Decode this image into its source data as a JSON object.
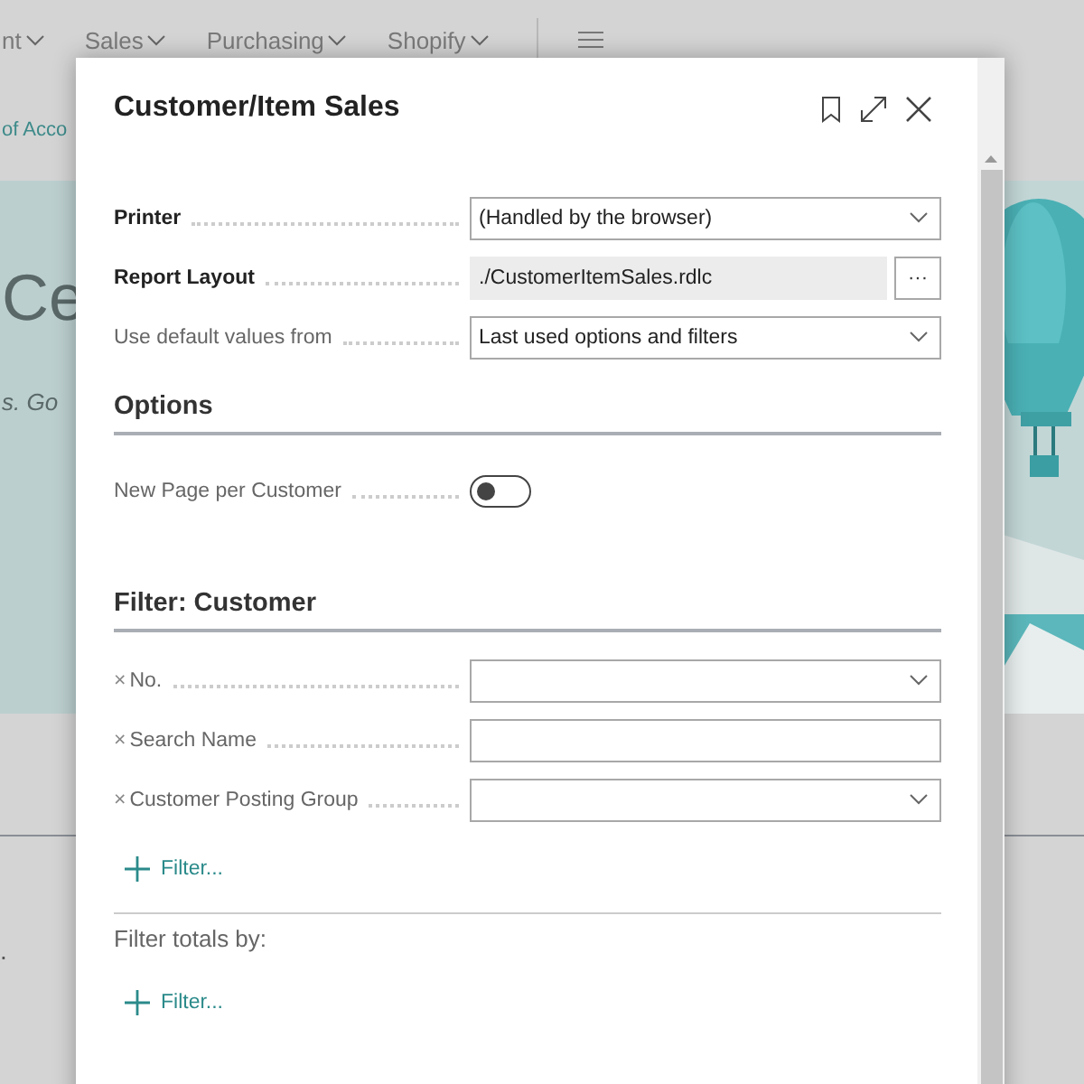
{
  "background": {
    "nav": [
      {
        "label": "nt"
      },
      {
        "label": "Sales"
      },
      {
        "label": "Purchasing"
      },
      {
        "label": "Shopify"
      }
    ],
    "link": "of Acco",
    "hero_title": "Ce",
    "hero_text": "s. Go",
    "footnote": "."
  },
  "dialog": {
    "title": "Customer/Item Sales",
    "fields": [
      {
        "label": "Printer",
        "bold": true,
        "kind": "dropdown",
        "value": "(Handled by the browser)"
      },
      {
        "label": "Report Layout",
        "bold": true,
        "kind": "lookup",
        "value": "./CustomerItemSales.rdlc",
        "button": "···"
      },
      {
        "label": "Use default values from",
        "bold": false,
        "kind": "dropdown",
        "value": "Last used options and filters"
      }
    ],
    "options": {
      "heading": "Options",
      "items": [
        {
          "label": "New Page per Customer",
          "on": false
        }
      ]
    },
    "filter": {
      "heading": "Filter: Customer",
      "remove": "×",
      "fields": [
        {
          "label": "No.",
          "kind": "dropdown"
        },
        {
          "label": "Search Name",
          "kind": "text"
        },
        {
          "label": "Customer Posting Group",
          "kind": "dropdown"
        }
      ],
      "add": "Filter..."
    },
    "totals": {
      "heading": "Filter totals by:",
      "add": "Filter..."
    }
  }
}
